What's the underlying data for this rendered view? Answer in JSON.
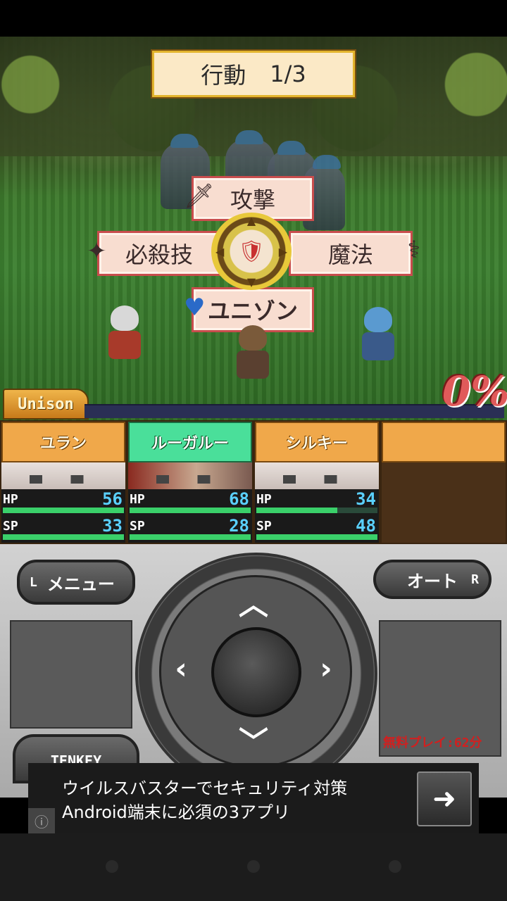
{
  "battle": {
    "action_label": "行動",
    "action_count": "1/3",
    "commands": {
      "attack": "攻撃",
      "special": "必殺技",
      "magic": "魔法",
      "unison": "ユニゾン"
    },
    "unison_label": "Unison",
    "unison_percent": "0%"
  },
  "party": [
    {
      "name": "ユラン",
      "active": false,
      "hp": "56",
      "sp": "33",
      "hp_fraction": 1.0,
      "sp_fraction": 1.0
    },
    {
      "name": "ルーガルー",
      "active": true,
      "hp": "68",
      "sp": "28",
      "hp_fraction": 1.0,
      "sp_fraction": 1.0
    },
    {
      "name": "シルキー",
      "active": false,
      "hp": "34",
      "sp": "48",
      "hp_fraction": 0.67,
      "sp_fraction": 1.0
    }
  ],
  "stat_labels": {
    "hp": "HP",
    "sp": "SP"
  },
  "controller": {
    "menu_key": "L",
    "menu_label": "メニュー",
    "auto_label": "オート",
    "auto_key": "R",
    "tenkey_label": "TENKEY",
    "free_play": "無料プレイ:62分",
    "dir_up": "︿",
    "dir_down": "﹀",
    "dir_left": "‹",
    "dir_right": "›"
  },
  "ad": {
    "line1": "ウイルスバスターでセキュリティ対策",
    "line2": "Android端末に必須の3アプリ",
    "go_icon": "arrow-right-icon",
    "info_icon": "info-icon"
  }
}
